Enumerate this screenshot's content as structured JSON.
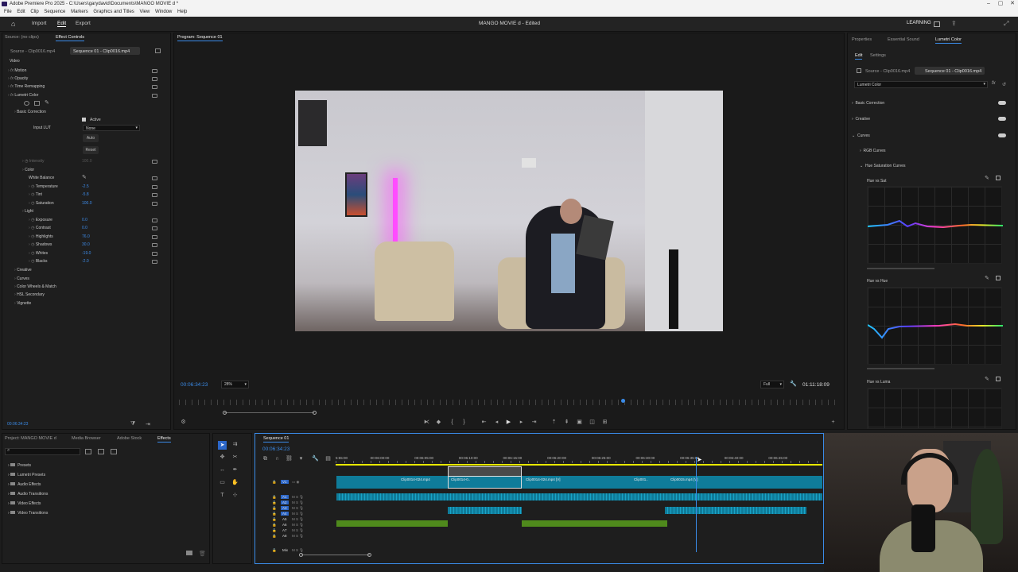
{
  "window": {
    "title": "Adobe Premiere Pro 2025 - C:\\Users\\garydavid\\Documents\\MANGO MOVIE d *"
  },
  "menu": [
    "File",
    "Edit",
    "Clip",
    "Sequence",
    "Markers",
    "Graphics and Titles",
    "View",
    "Window",
    "Help"
  ],
  "topbar": {
    "import": "Import",
    "edit": "Edit",
    "export": "Export",
    "project_title": "MANGO MOVIE d - Edited",
    "learning": "LEARNING"
  },
  "source_panel": {
    "tab1": "Source: (no clips)",
    "tab2": "Effect Controls",
    "clip_a": "Source - Clip0016.mp4",
    "clip_b": "Sequence 01 - Clip0016.mp4",
    "section_video": "Video"
  },
  "effects": [
    {
      "label": "Motion",
      "indent": 1,
      "fx": true
    },
    {
      "label": "Opacity",
      "indent": 1,
      "fx": true
    },
    {
      "label": "Time Remapping",
      "indent": 1,
      "fx": true
    },
    {
      "label": "Lumetri Color",
      "indent": 1,
      "fx": true
    },
    {
      "label": "Basic Correction",
      "indent": 2
    },
    {
      "label": "Intensity",
      "indent": 3,
      "dim": true,
      "value": "100.0"
    },
    {
      "label": "Color",
      "indent": 3
    },
    {
      "label": "White Balance",
      "indent": 4
    },
    {
      "label": "Temperature",
      "indent": 4,
      "value": "-2.5"
    },
    {
      "label": "Tint",
      "indent": 4,
      "value": "-5.8"
    },
    {
      "label": "Saturation",
      "indent": 4,
      "value": "100.0"
    },
    {
      "label": "Light",
      "indent": 3
    },
    {
      "label": "Exposure",
      "indent": 4,
      "value": "0.0"
    },
    {
      "label": "Contrast",
      "indent": 4,
      "value": "0.0"
    },
    {
      "label": "Highlights",
      "indent": 4,
      "value": "76.0"
    },
    {
      "label": "Shadows",
      "indent": 4,
      "value": "30.0"
    },
    {
      "label": "Whites",
      "indent": 4,
      "value": "-19.0"
    },
    {
      "label": "Blacks",
      "indent": 4,
      "value": "-2.0"
    },
    {
      "label": "Creative",
      "indent": 2
    },
    {
      "label": "Curves",
      "indent": 2
    },
    {
      "label": "Color Wheels & Match",
      "indent": 2
    },
    {
      "label": "HSL Secondary",
      "indent": 2
    },
    {
      "label": "Vignette",
      "indent": 2
    }
  ],
  "basic": {
    "active": "Active",
    "input_lut": "Input LUT",
    "lut_value": "None",
    "auto": "Auto",
    "reset": "Reset"
  },
  "source_timecode": "00:06:34:23",
  "program": {
    "title": "Program: Sequence 01",
    "timecode": "00:06:34:23",
    "zoom": "28%",
    "quality": "Full",
    "duration": "01:11:18:09"
  },
  "lumetri": {
    "tabs": [
      "Properties",
      "Essential Sound",
      "Lumetri Color"
    ],
    "subtabs": [
      "Edit",
      "Settings"
    ],
    "clip_a": "Source - Clip0016.mp4",
    "clip_b": "Sequence 01 - Clip0016.mp4",
    "preset": "Lumetri Color",
    "sections": [
      "Basic Correction",
      "Creative",
      "Curves"
    ],
    "subsections": [
      "RGB Curves",
      "Hue Saturation Curves"
    ],
    "curves": [
      "Hue vs Sat",
      "Hue vs Hue",
      "Hue vs Luma"
    ]
  },
  "project": {
    "tabs": [
      "Project: MANGO MOVIE d",
      "Media Browser",
      "Adobe Stock",
      "Effects"
    ],
    "folders": [
      "Presets",
      "Lumetri Presets",
      "Audio Effects",
      "Audio Transitions",
      "Video Effects",
      "Video Transitions"
    ]
  },
  "timeline": {
    "tab": "Sequence 01",
    "timecode": "00:06:34:23",
    "ruler": [
      "5:55:00",
      "00:06:00:00",
      "00:06:05:00",
      "00:06:10:00",
      "00:06:15:00",
      "00:06:20:00",
      "00:06:25:00",
      "00:06:30:00",
      "00:06:35:00",
      "00:06:40:00",
      "00:06:45:00"
    ],
    "tracks": [
      "V1",
      "A1",
      "A2",
      "A3",
      "A4",
      "A5",
      "A6",
      "A7",
      "A8",
      "Mix"
    ],
    "clips": [
      "Clip0014-024.mp4",
      "Clip0014-0..",
      "Clip0014-024.mp4 [V]",
      "Clip001..",
      "Clip0015.mp4 [V]"
    ]
  },
  "colors": {
    "accent": "#3a8be8",
    "track": "#0f7c9a",
    "audio_green": "#4f8a1c"
  }
}
